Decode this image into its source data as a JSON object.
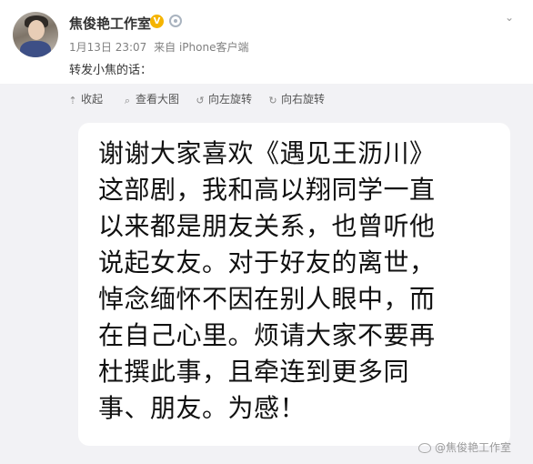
{
  "post": {
    "username": "焦俊艳工作室",
    "verified_mark": "V",
    "time": "1月13日 23:07",
    "source": "来自 iPhone客户端",
    "repost_text": "转发小焦的话："
  },
  "toolbar": {
    "collapse": "收起",
    "view_large": "查看大图",
    "rotate_left": "向左旋转",
    "rotate_right": "向右旋转"
  },
  "image_text": {
    "lines": [
      "谢谢大家喜欢《遇见王沥川》",
      "这部剧，我和高以翔同学一直",
      "以来都是朋友关系，也曾听他",
      "说起女友。对于好友的离世，",
      "悼念缅怀不因在别人眼中，而",
      "在自己心里。烦请大家不要再",
      "杜撰此事，且牵连到更多同",
      "事、朋友。为感！"
    ]
  },
  "watermark": "@焦俊艳工作室",
  "icons": {
    "avatar": "avatar-photo",
    "verified": "verified-badge-icon",
    "member": "member-badge-icon",
    "more": "chevron-down-icon",
    "collapse": "arrow-up-icon",
    "view": "magnifier-icon",
    "rotate_left": "rotate-left-icon",
    "rotate_right": "rotate-right-icon",
    "weibo": "weibo-logo-icon"
  },
  "colors": {
    "verified": "#f5b400",
    "media_bg": "#f2f2f5",
    "card_bg": "#ffffff"
  }
}
